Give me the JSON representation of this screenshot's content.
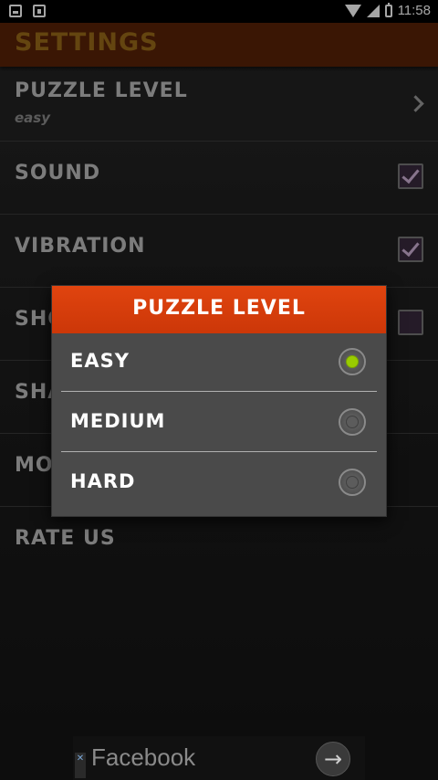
{
  "status_bar": {
    "time": "11:58",
    "icons": [
      "photo-icon",
      "notification-icon",
      "wifi-icon",
      "signal-icon",
      "battery-icon"
    ]
  },
  "app": {
    "title": "SETTINGS",
    "title_color": "#9a6a1a",
    "header_color": "#5a2307"
  },
  "settings": {
    "items": [
      {
        "label": "PUZZLE LEVEL",
        "summary": "easy",
        "control": "chevron"
      },
      {
        "label": "SOUND",
        "control": "checkbox",
        "checked": true
      },
      {
        "label": "VIBRATION",
        "control": "checkbox",
        "checked": true
      },
      {
        "label": "SHO",
        "control": "checkbox",
        "checked": false
      },
      {
        "label": "SHA",
        "control": "none"
      },
      {
        "label": "MO",
        "control": "none"
      },
      {
        "label": "RATE US",
        "control": "none"
      }
    ]
  },
  "dialog": {
    "title": "PUZZLE LEVEL",
    "header_color": "#dc410d",
    "options": [
      {
        "label": "EASY",
        "selected": true
      },
      {
        "label": "MEDIUM",
        "selected": false
      },
      {
        "label": "HARD",
        "selected": false
      }
    ]
  },
  "ad": {
    "text": "Facebook",
    "arrow": "→",
    "close": "✕"
  }
}
